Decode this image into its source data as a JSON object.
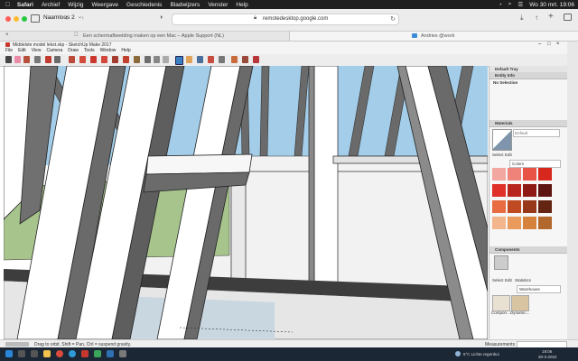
{
  "menubar": {
    "apple": "",
    "app": "Safari",
    "items": [
      "Archief",
      "Wijzig",
      "Weergave",
      "Geschiedenis",
      "Bladwijzers",
      "Venster",
      "Help"
    ],
    "datetime": "Wo 30 mrt.  19:06"
  },
  "safari": {
    "tab_group": "Naamloos 2",
    "url": "remotedesktop.google.com",
    "tabs": [
      {
        "title": "Een schermafbeelding maken op een Mac – Apple Support (NL)"
      },
      {
        "title": "Andries @work"
      }
    ]
  },
  "sketchup": {
    "title": "Middelste model lekst.skp - SketchUp Make 2017",
    "menu": [
      "File",
      "Edit",
      "View",
      "Camera",
      "Draw",
      "Tools",
      "Window",
      "Help"
    ],
    "status": "Drag to orbit. Shift = Pan, Ctrl = suspend gravity.",
    "measurements_label": "Measurements"
  },
  "tray": {
    "title": "Default Tray",
    "entity_info": {
      "header": "Entity Info",
      "value": "No Selection"
    },
    "materials": {
      "header": "Materials",
      "preview_name": "Default",
      "tabs": [
        "Select",
        "Edit"
      ],
      "dropdown": "Colors",
      "swatches": [
        "#f2a7a0",
        "#ef8379",
        "#e85346",
        "#d8271c",
        "#e0302a",
        "#b8251f",
        "#8e1a15",
        "#5e1410",
        "#e86b42",
        "#c04a21",
        "#97381a",
        "#632512",
        "#f3b58b",
        "#e99a5d",
        "#d6823c",
        "#b2672c"
      ]
    },
    "components": {
      "header": "Components",
      "tabs": [
        "Select",
        "Edit",
        "Statistics"
      ],
      "dropdown": "Warehouse",
      "items": [
        "Compon...",
        "Dynamic..."
      ]
    }
  },
  "taskbar": {
    "weather": "5°C  Lichte regenbui",
    "time": "19:06",
    "date": "30-3-2022"
  },
  "colors": {
    "sky": "#a3cde8",
    "wood_light": "#f4f4f4",
    "wood_dark": "#6a6a6a",
    "grass": "#a6c48c",
    "ground_dark": "#3d3d3d",
    "water": "#c9d7e0"
  }
}
